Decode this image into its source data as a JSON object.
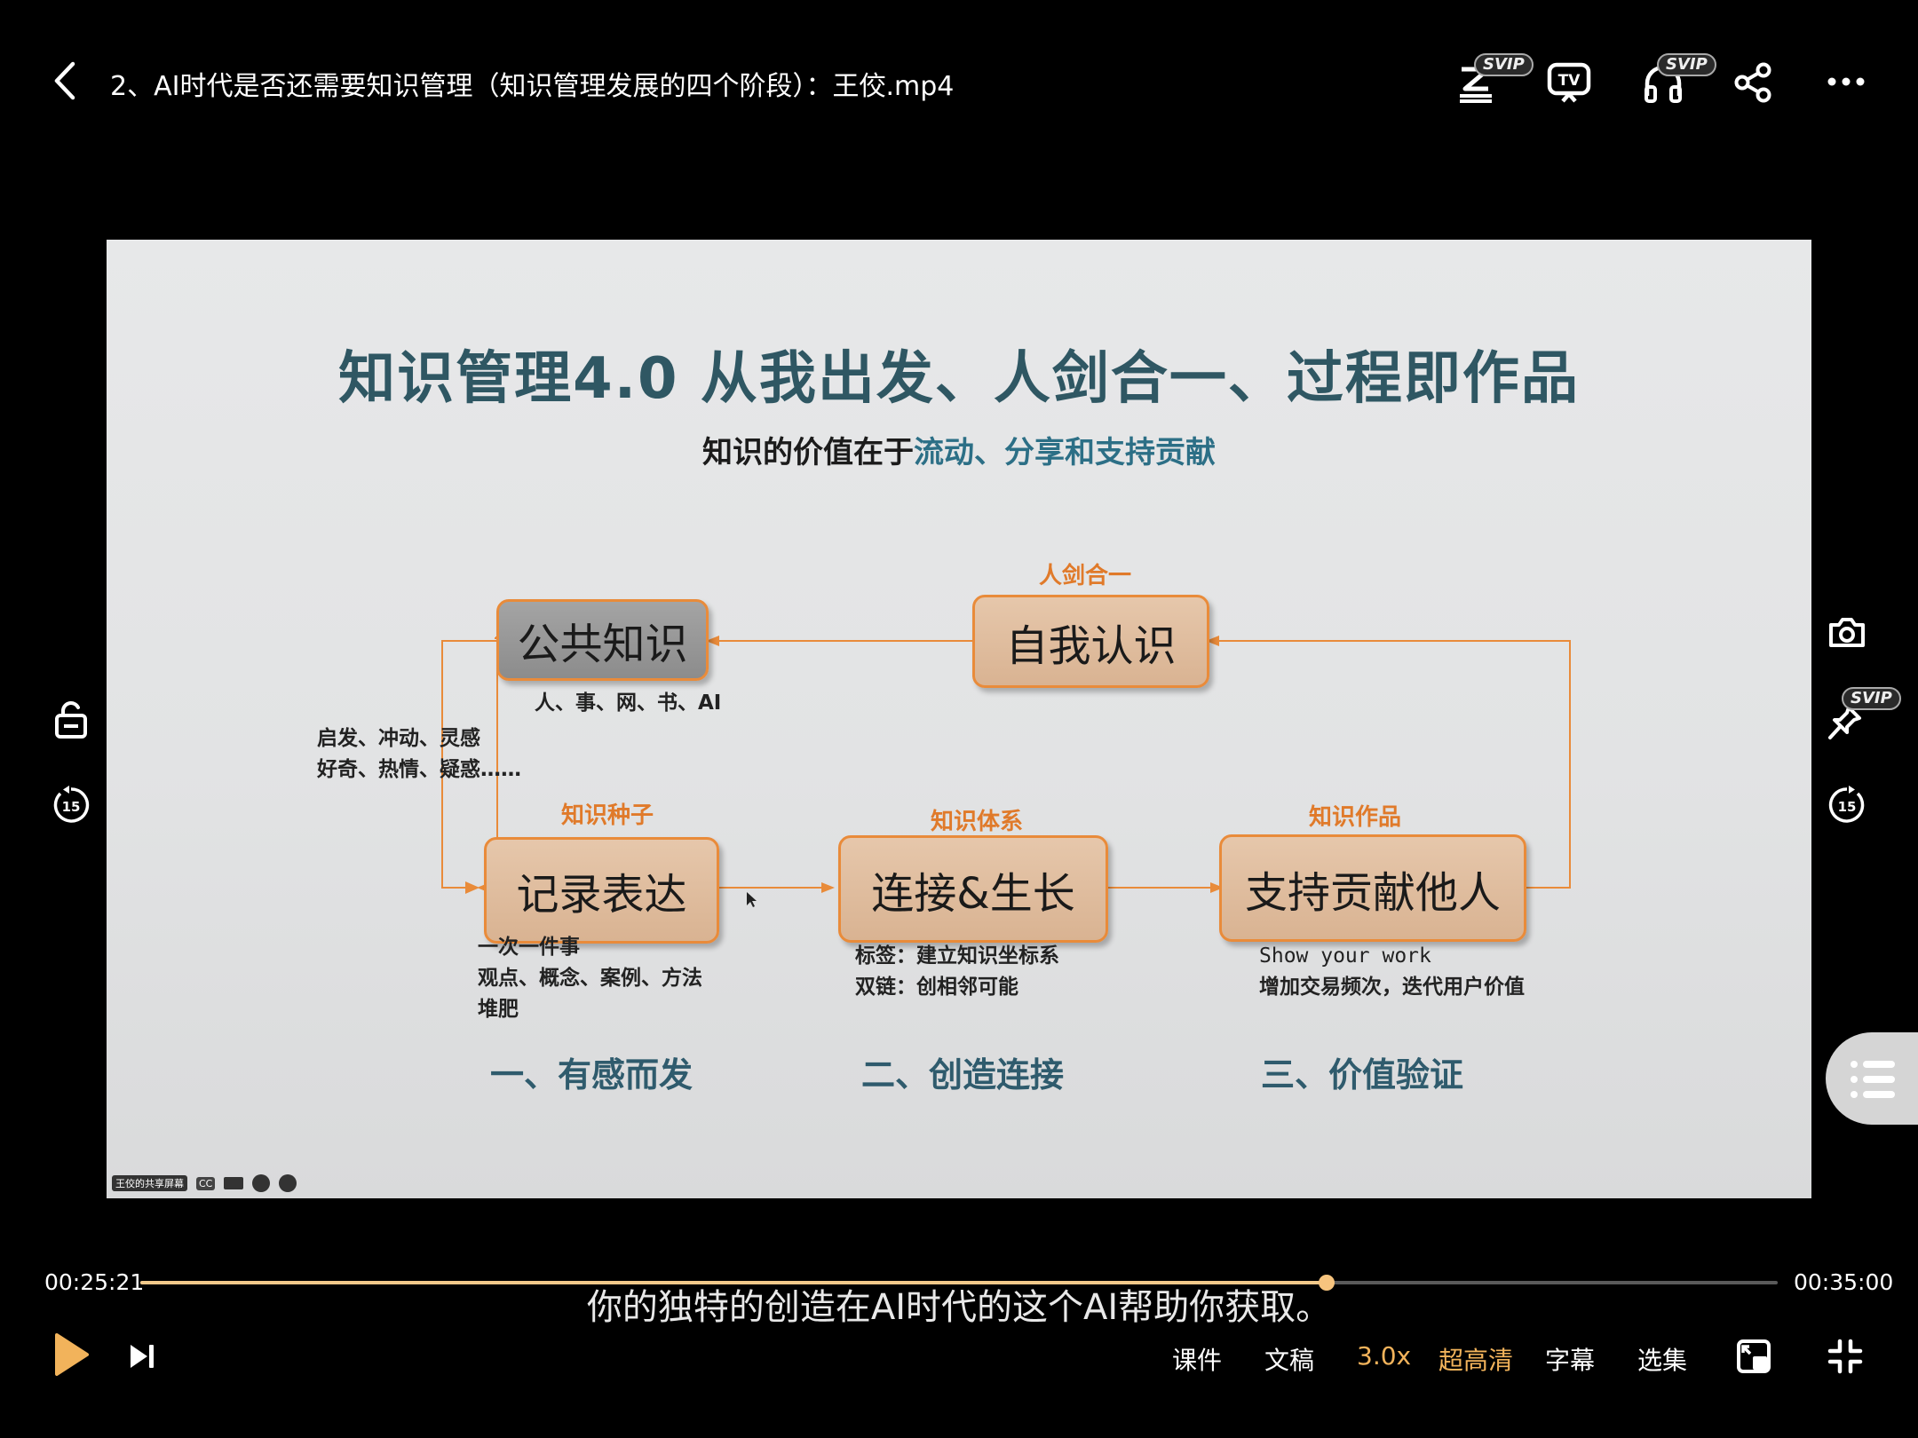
{
  "header": {
    "title": "2、AI时代是否还需要知识管理（知识管理发展的四个阶段）：王佼.mp4",
    "vip_badge": "SVIP"
  },
  "slide": {
    "title": "知识管理4.0  从我出发、人剑合一、过程即作品",
    "subtitle_dark": "知识的价值在于",
    "subtitle_blue": "流动、分享和支持贡献",
    "boxes": {
      "public_knowledge": "公共知识",
      "self_awareness": "自我认识",
      "record_express": "记录表达",
      "connect_grow": "连接&生长",
      "support_contribute": "支持贡献他人"
    },
    "labels": {
      "self_label": "人剑合一",
      "seed_label": "知识种子",
      "system_label": "知识体系",
      "works_label": "知识作品"
    },
    "notes": {
      "public_sources": "人、事、网、书、AI",
      "inspiration_1": "启发、冲动、灵感",
      "inspiration_2": "好奇、热情、疑惑……",
      "record_1": "一次一件事",
      "record_2": "观点、概念、案例、方法",
      "record_3": "堆肥",
      "connect_1": "标签：建立知识坐标系",
      "connect_2": "双链：创相邻可能",
      "support_1": "Show your work",
      "support_2": "增加交易频次，迭代用户价值"
    },
    "stages": {
      "stage_1": "一、有感而发",
      "stage_2": "二、创造连接",
      "stage_3": "三、价值验证"
    },
    "share_bar_label": "王佼的共享屏幕",
    "share_cc": "CC"
  },
  "player": {
    "current_time": "00:25:21",
    "total_time": "00:35:00",
    "progress": 0.7243,
    "subtitle": "你的独特的创造在AI时代的这个AI帮助你获取。",
    "side_skip": "15",
    "controls": {
      "courseware": "课件",
      "transcript": "文稿",
      "speed": "3.0x",
      "quality": "超高清",
      "captions": "字幕",
      "episodes": "选集"
    }
  },
  "colors": {
    "accent": "#f2b35b",
    "slide_title": "#2f5763",
    "box_border": "#e98b3a",
    "stage_text": "#2f5b6d"
  }
}
